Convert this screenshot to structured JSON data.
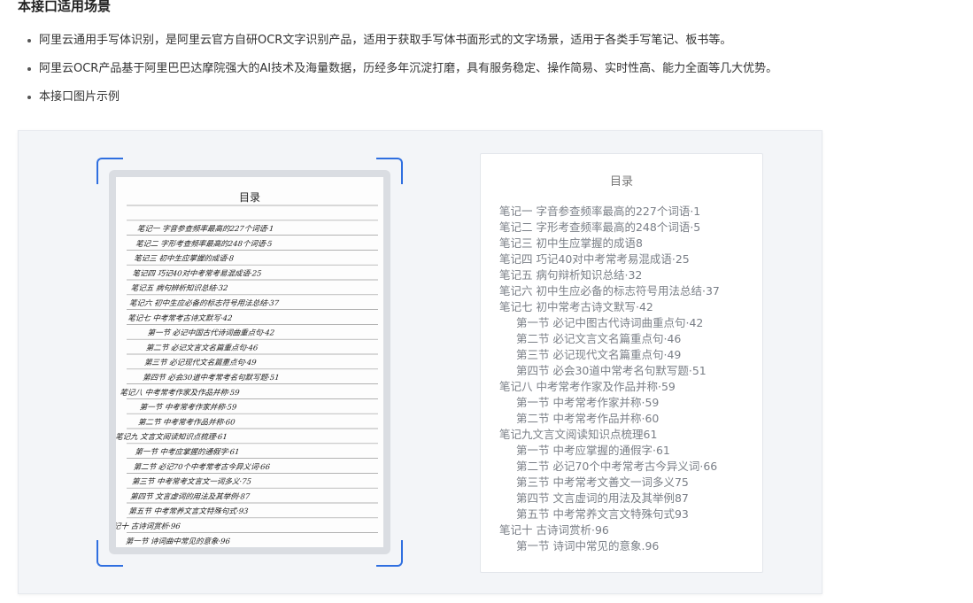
{
  "section_title": "本接口适用场景",
  "bullets": [
    "阿里云通用手写体识别，是阿里云官方自研OCR文字识别产品，适用于获取手写体书面形式的文字场景，适用于各类手写笔记、板书等。",
    "阿里云OCR产品基于阿里巴巴达摩院强大的AI技术及海量数据，历经多年沉淀打磨，具有服务稳定、操作简易、实时性高、能力全面等几大优势。",
    "本接口图片示例"
  ],
  "handwritten_image": {
    "title": "目录",
    "lines": [
      "笔记一  字音参查频率最高的227个词语·1",
      "笔记二  字形考查频率最高的248个词语·5",
      "笔记三  初中生应掌握的成语·8",
      "笔记四  巧记40对中考常考易混成语·25",
      "笔记五  病句辨析知识总结·32",
      "笔记六  初中生应必备的标志符号用法总结·37",
      "笔记七  中考常考古诗文默写·42",
      "第一节  必记中国古代诗词曲重点句·42",
      "第二节  必记文言文名篇重点句·46",
      "第三节  必记现代文名篇重点句·49",
      "第四节  必会30道中考常考名句默写题·51",
      "笔记八  中考常考作家及作品并称·59",
      "第一节  中考常考作家并称·59",
      "第二节  中考常考作品并称·60",
      "笔记九  文言文阅读知识点梳理·61",
      "第一节  中考应掌握的通假字·61",
      "第二节  必记70个中考常考古今异义词·66",
      "第三节  中考常考文言文一词多义·75",
      "第四节  文言虚词的用法及其举例·87",
      "第五节  中考常养文言文特殊句式·93",
      "笔记十  古诗词赏析·96",
      "第一节  诗词曲中常见的意象·96"
    ]
  },
  "result": {
    "title": "目录",
    "items": [
      {
        "text": "笔记一 字音参查频率最高的227个词语·1",
        "indent": false
      },
      {
        "text": "笔记二 字形考查频率最高的248个词语·5",
        "indent": false
      },
      {
        "text": "笔记三 初中生应掌握的成语8",
        "indent": false
      },
      {
        "text": "笔记四 巧记40对中考常考易混成语·25",
        "indent": false
      },
      {
        "text": "笔记五 病句辩析知识总结·32",
        "indent": false
      },
      {
        "text": "笔记六 初中生应必备的标志符号用法总结·37",
        "indent": false
      },
      {
        "text": "笔记七 初中常考古诗文默写·42",
        "indent": false
      },
      {
        "text": "第一节 必记中图古代诗词曲重点句·42",
        "indent": true
      },
      {
        "text": "第二节 必记文言文名篇重点句·46",
        "indent": true
      },
      {
        "text": "第三节 必记现代文名篇重点句·49",
        "indent": true
      },
      {
        "text": "第四节 必会30道中常考名句默写题·51",
        "indent": true
      },
      {
        "text": "笔记八 中考常考作家及作品并称·59",
        "indent": false
      },
      {
        "text": "第一节 中考常考作家并称·59",
        "indent": true
      },
      {
        "text": "第二节 中考常考作品并称·60",
        "indent": true
      },
      {
        "text": "笔记九文言文阅读知识点梳理61",
        "indent": false
      },
      {
        "text": "第一节 中考应掌握的通假字·61",
        "indent": true
      },
      {
        "text": "第二节 必记70个中考常考古今异义词·66",
        "indent": true
      },
      {
        "text": "第三节 中考常考文善文一词多义75",
        "indent": true
      },
      {
        "text": "第四节 文言虚词的用法及其举例87",
        "indent": true
      },
      {
        "text": "第五节 中考常养文言文特殊句式93",
        "indent": true
      },
      {
        "text": "笔记十 古诗词赏析·96",
        "indent": false
      },
      {
        "text": "第一节 诗词中常见的意象.96",
        "indent": true
      }
    ]
  },
  "colors": {
    "accent": "#2f6fe0",
    "panel_bg": "#f3f5f8",
    "result_text": "#7a7f87"
  }
}
